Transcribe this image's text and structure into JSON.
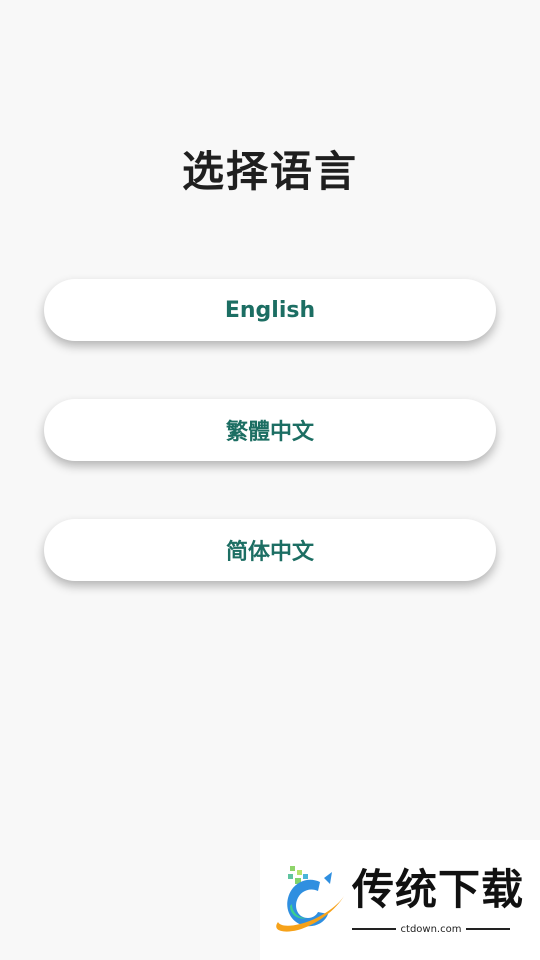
{
  "page": {
    "title": "选择语言"
  },
  "languages": [
    {
      "label": "English"
    },
    {
      "label": "繁體中文"
    },
    {
      "label": "简体中文"
    }
  ],
  "colors": {
    "background": "#f8f8f8",
    "button_background": "#ffffff",
    "button_text": "#1c6e63",
    "title_text": "#1f1f1f"
  },
  "watermark": {
    "brand": "传统下载",
    "url": "ctdown.com",
    "icon": "ctdown-logo-icon"
  }
}
